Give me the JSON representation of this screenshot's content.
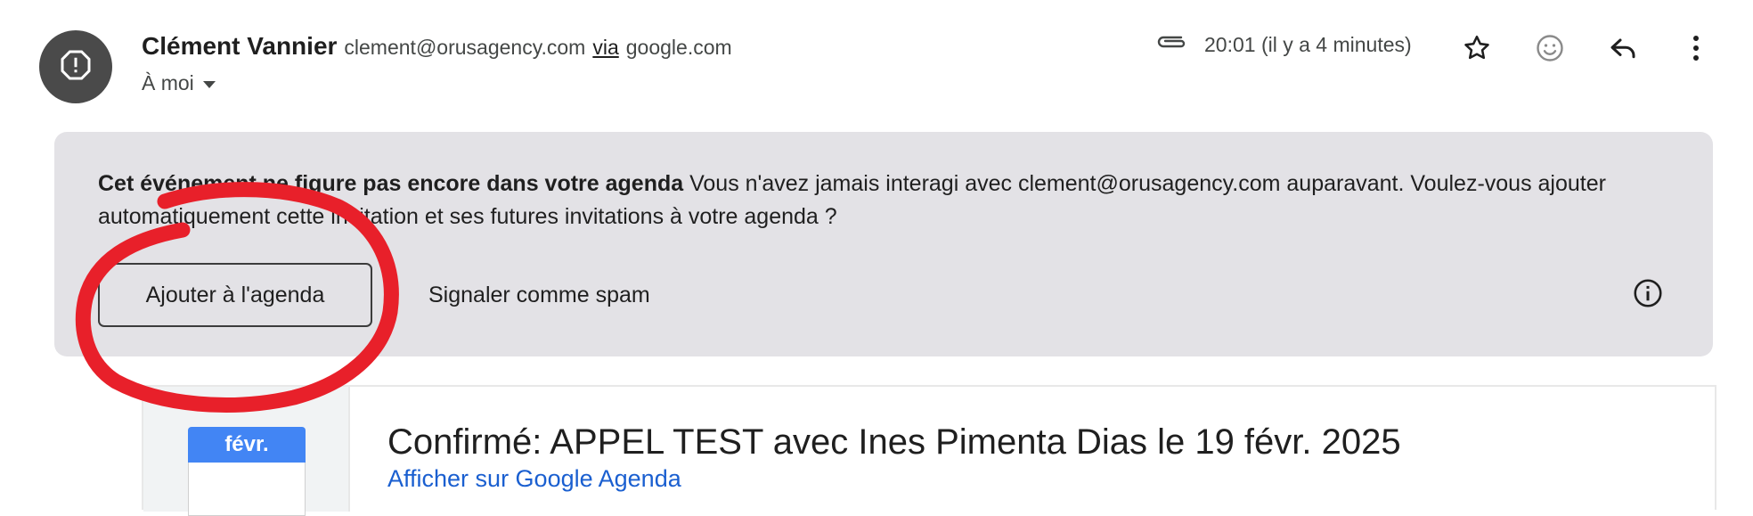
{
  "header": {
    "sender_name": "Clément Vannier",
    "sender_email": "clement@orusagency.com",
    "via_label": "via",
    "via_domain": "google.com",
    "recipient": "À moi",
    "time": "20:01 (il y a 4 minutes)",
    "icons": [
      "alert-icon",
      "attachment-icon",
      "star-icon",
      "emoji-icon",
      "reply-icon",
      "more-icon"
    ]
  },
  "banner": {
    "bold_text": "Cet événement ne figure pas encore dans votre agenda",
    "text": " Vous n'avez jamais interagi avec clement@orusagency.com auparavant. Voulez-vous ajouter automatiquement cette invitation et ses futures invitations à votre agenda ?",
    "add_button": "Ajouter à l'agenda",
    "spam_button": "Signaler comme spam"
  },
  "event": {
    "month": "févr.",
    "title": "Confirmé: APPEL TEST avec Ines Pimenta Dias le 19 févr. 2025",
    "link": "Afficher sur Google Agenda"
  },
  "colors": {
    "banner_bg": "#e3e2e6",
    "avatar_bg": "#4a4a4a",
    "calendar_month_bg": "#4285f4",
    "link": "#1a5fd0",
    "annotation_red": "#e8202a"
  }
}
